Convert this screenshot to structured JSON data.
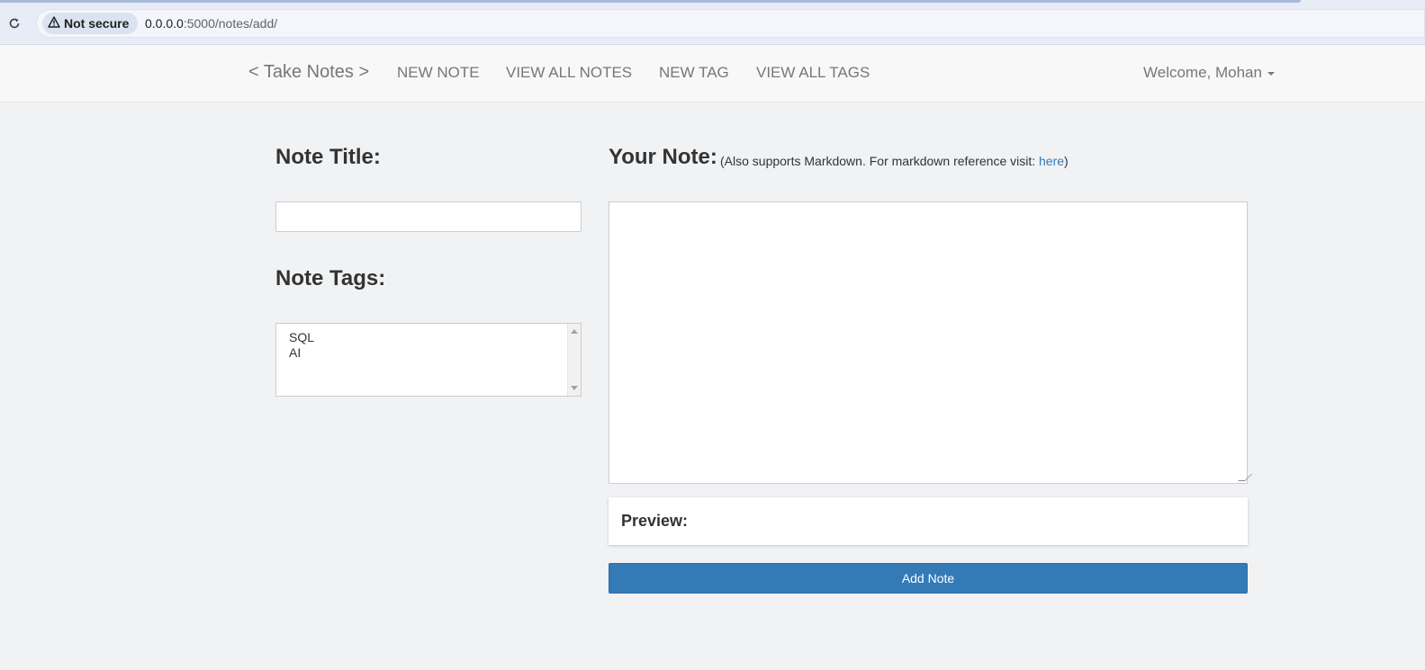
{
  "browser": {
    "security_label": "Not secure",
    "url_host": "0.0.0.0",
    "url_path": ":5000/notes/add/",
    "reload_icon": "reload-icon",
    "warning_icon": "warning-triangle-icon"
  },
  "navbar": {
    "brand": "< Take Notes >",
    "links": [
      "NEW NOTE",
      "VIEW ALL NOTES",
      "NEW TAG",
      "VIEW ALL TAGS"
    ],
    "welcome": "Welcome, Mohan"
  },
  "form": {
    "title_heading": "Note Title:",
    "title_value": "",
    "tags_heading": "Note Tags:",
    "tags": [
      "SQL",
      "AI"
    ],
    "note_heading": "Your Note:",
    "markdown_prefix": "(Also supports Markdown. For markdown reference visit: ",
    "markdown_link": "here",
    "markdown_suffix": ")",
    "note_value": "",
    "preview_label": "Preview:",
    "submit_label": "Add Note"
  },
  "colors": {
    "primary": "#337ab7",
    "link": "#337ab7",
    "background": "#f1f2f4"
  }
}
